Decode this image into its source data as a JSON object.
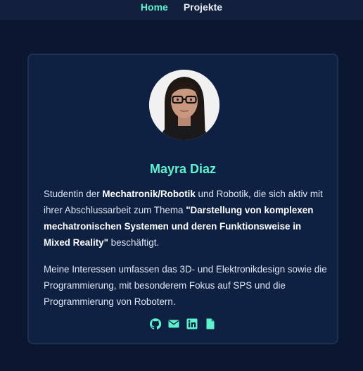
{
  "nav": {
    "items": [
      {
        "label": "Home",
        "active": true
      },
      {
        "label": "Projekte",
        "active": false
      }
    ]
  },
  "profile": {
    "name": "Mayra Diaz",
    "bio1": {
      "t1": "Studentin der ",
      "b1": "Mechatronik/Robotik",
      "t2": " und Robotik, die sich aktiv mit ihrer Abschlussarbeit zum Thema ",
      "b2": "\"Darstellung von komplexen mechatronischen Systemen und deren Funktionsweise in Mixed Reality\"",
      "t3": " beschäftigt."
    },
    "bio2": "Meine Interessen umfassen das 3D- und Elektronikdesign sowie die Programmierung, mit besonderem Fokus auf SPS und die Programmierung von Robotern."
  },
  "social_links": [
    {
      "icon": "github-icon"
    },
    {
      "icon": "envelope-icon"
    },
    {
      "icon": "linkedin-icon"
    },
    {
      "icon": "file-icon"
    }
  ],
  "colors": {
    "background": "#0b1730",
    "navbar": "#12203d",
    "card": "#0f2142",
    "card_border": "#1e3050",
    "accent": "#5ef2cf",
    "text": "#dfe6f3"
  }
}
